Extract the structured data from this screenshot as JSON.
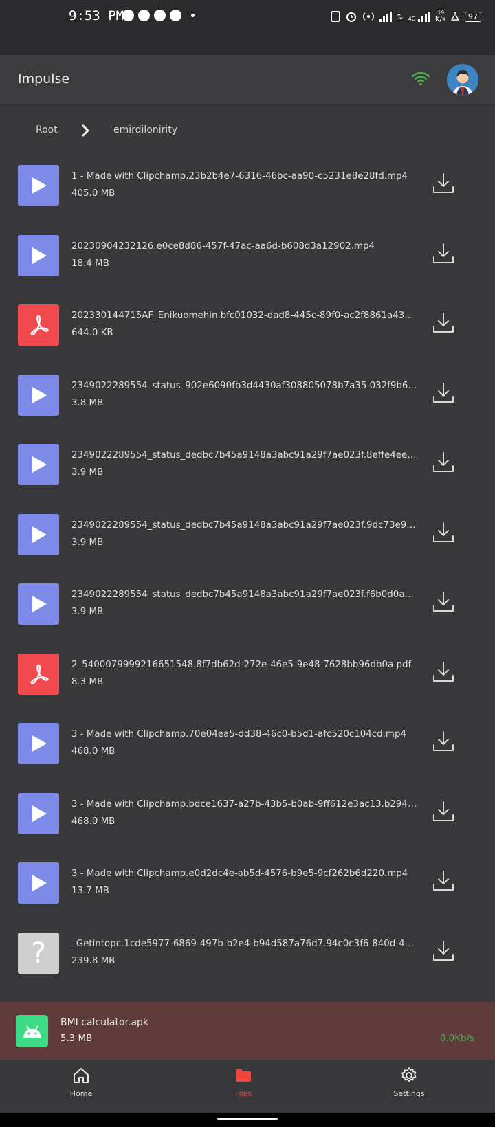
{
  "status_bar": {
    "time": "9:53 PM",
    "network": "4G",
    "speed_value": "34",
    "speed_unit": "K/s",
    "battery": "97"
  },
  "app": {
    "title": "Impulse",
    "connection_color": "#4caf50"
  },
  "breadcrumb": {
    "root": "Root",
    "current": "emirdilonirity"
  },
  "files": [
    {
      "name": "1 - Made with Clipchamp.23b2b4e7-6316-46bc-aa90-c5231e8e28fd.mp4",
      "size": "405.0 MB",
      "kind": "video"
    },
    {
      "name": "20230904232126.e0ce8d86-457f-47ac-aa6d-b608d3a12902.mp4",
      "size": "18.4 MB",
      "kind": "video"
    },
    {
      "name": "202330144715AF_Enikuomehin.bfc01032-dad8-445c-89f0-ac2f8861a433.p...",
      "size": "644.0 KB",
      "kind": "pdf"
    },
    {
      "name": "2349022289554_status_902e6090fb3d4430af308805078b7a35.032f9b6...",
      "size": "3.8 MB",
      "kind": "video"
    },
    {
      "name": "2349022289554_status_dedbc7b45a9148a3abc91a29f7ae023f.8effe4ee-7...",
      "size": "3.9 MB",
      "kind": "video"
    },
    {
      "name": "2349022289554_status_dedbc7b45a9148a3abc91a29f7ae023f.9dc73e9b-...",
      "size": "3.9 MB",
      "kind": "video"
    },
    {
      "name": "2349022289554_status_dedbc7b45a9148a3abc91a29f7ae023f.f6b0d0a1-...",
      "size": "3.9 MB",
      "kind": "video"
    },
    {
      "name": "2_5400079999216651548.8f7db62d-272e-46e5-9e48-7628bb96db0a.pdf",
      "size": "8.3 MB",
      "kind": "pdf"
    },
    {
      "name": "3 - Made with Clipchamp.70e04ea5-dd38-46c0-b5d1-afc520c104cd.mp4",
      "size": "468.0 MB",
      "kind": "video"
    },
    {
      "name": "3 - Made with Clipchamp.bdce1637-a27b-43b5-b0ab-9ff612e3ac13.b294fe...",
      "size": "468.0 MB",
      "kind": "video"
    },
    {
      "name": "3 - Made with Clipchamp.e0d2dc4e-ab5d-4576-b9e5-9cf262b6d220.mp4",
      "size": "13.7 MB",
      "kind": "video"
    },
    {
      "name": "_Getintopc.1cde5977-6869-497b-b2e4-b94d587a76d7.94c0c3f6-840d-4765...",
      "size": "239.8 MB",
      "kind": "unknown"
    }
  ],
  "active_download": {
    "name": "BMI calculator.apk",
    "size": "5.3 MB",
    "speed": "0.0Kb/s"
  },
  "nav": {
    "home": "Home",
    "files": "Files",
    "settings": "Settings"
  },
  "colors": {
    "video_thumb": "#7e8ae8",
    "pdf_thumb": "#f04a4f",
    "unknown_thumb": "#cfcfcf",
    "active_tab": "#f0443f",
    "download_panel": "#5f3b3c"
  }
}
